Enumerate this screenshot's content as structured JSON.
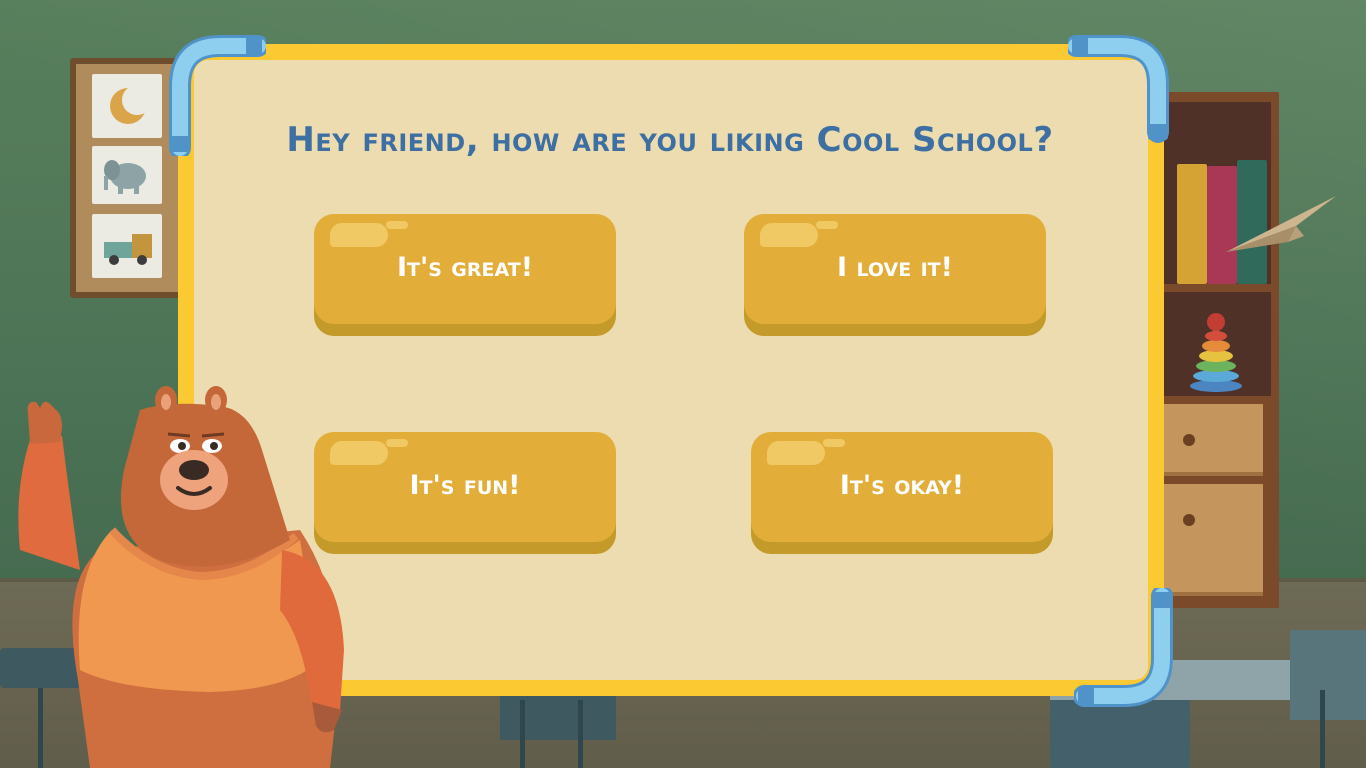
{
  "question": "Hey friend, how are you liking Cool School?",
  "answers": [
    {
      "label": "It's great!"
    },
    {
      "label": "I love it!"
    },
    {
      "label": "It's fun!"
    },
    {
      "label": "It's okay!"
    }
  ],
  "colors": {
    "panel_frame": "#fbc932",
    "panel_fill": "#eddcb0",
    "button": "#e2ae39",
    "button_shadow": "#c49a2b",
    "title_text": "#3e6fa3",
    "pipe": "#8ecff0",
    "wall": "#587f5c"
  },
  "icons": {
    "bear": "bear-character-waving",
    "paper_plane": "paper-plane",
    "moon": "moon-drawing",
    "elephant": "elephant-drawing",
    "truck": "truck-drawing",
    "ring_stacker": "ring-stacker-toy"
  }
}
